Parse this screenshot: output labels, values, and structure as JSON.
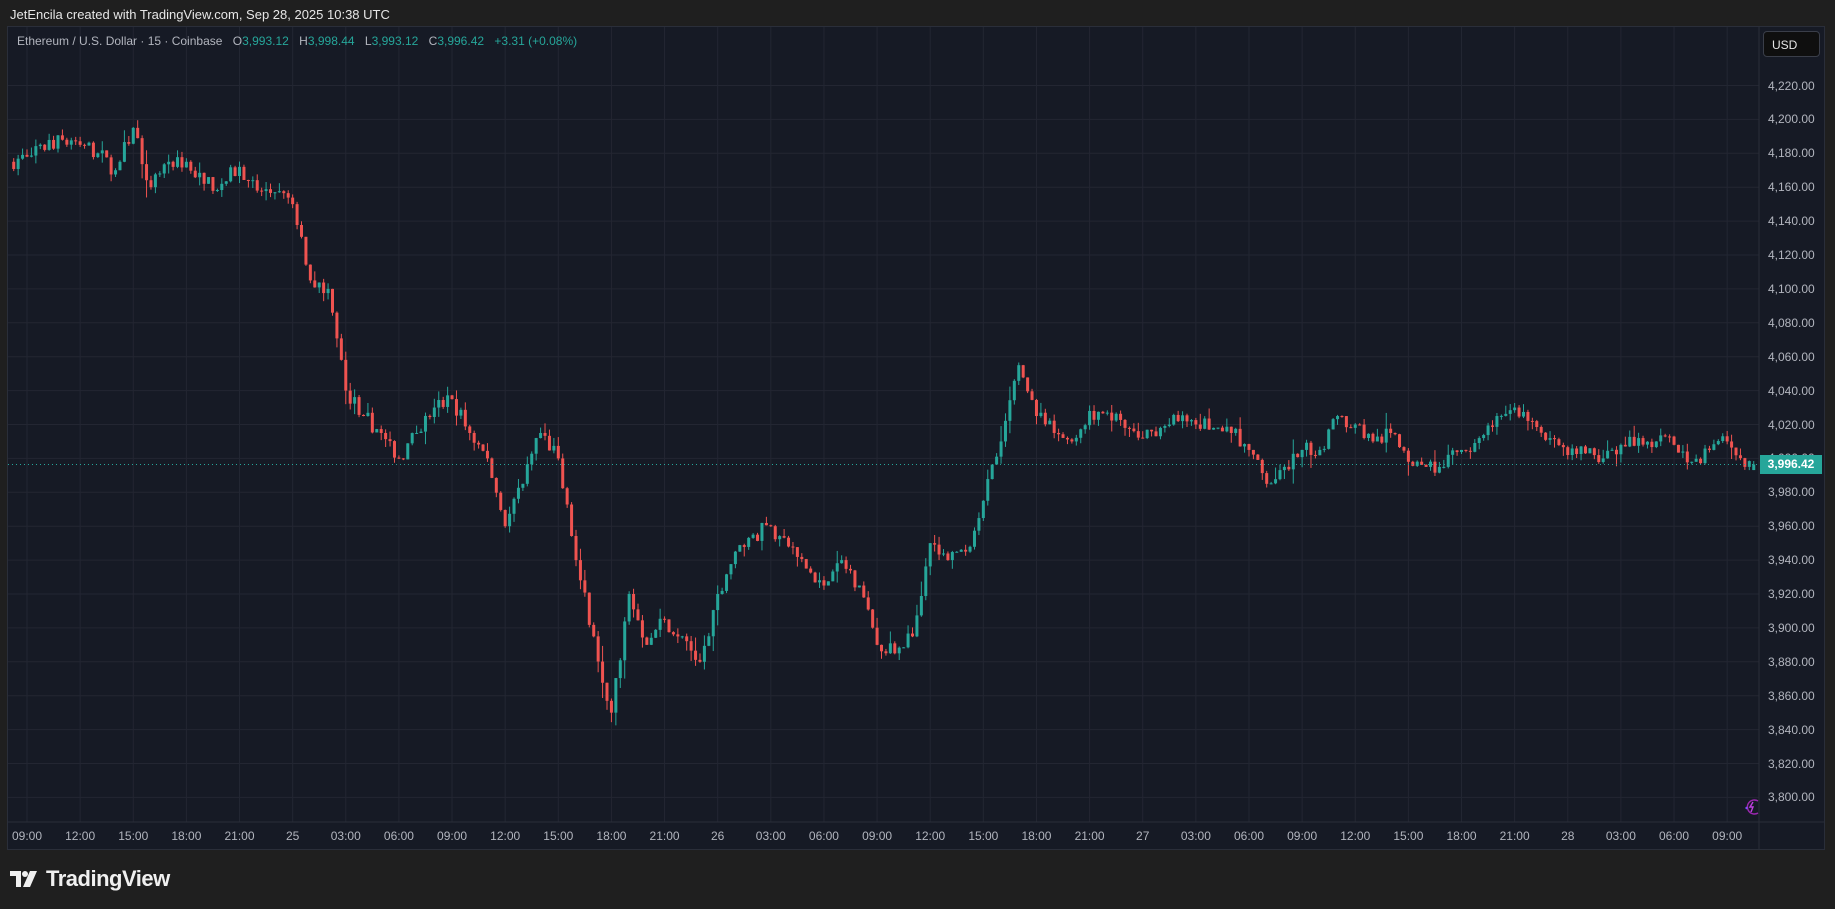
{
  "attribution": "JetEncila created with TradingView.com, Sep 28, 2025 10:38 UTC",
  "legend": {
    "symbol": "Ethereum / U.S. Dollar · 15 · Coinbase",
    "open_key": "O",
    "open": "3,993.12",
    "high_key": "H",
    "high": "3,998.44",
    "low_key": "L",
    "low": "3,993.12",
    "close_key": "C",
    "close": "3,996.42",
    "change": "+3.31 (+0.08%)"
  },
  "currency_button": "USD",
  "current_price_label": "3,996.42",
  "price_axis_labels": [
    "4,220.00",
    "4,200.00",
    "4,180.00",
    "4,160.00",
    "4,140.00",
    "4,120.00",
    "4,100.00",
    "4,080.00",
    "4,060.00",
    "4,040.00",
    "4,020.00",
    "4,000.00",
    "3,980.00",
    "3,960.00",
    "3,940.00",
    "3,920.00",
    "3,900.00",
    "3,880.00",
    "3,860.00",
    "3,840.00",
    "3,820.00",
    "3,800.00"
  ],
  "time_axis_labels": [
    "09:00",
    "12:00",
    "15:00",
    "18:00",
    "21:00",
    "25",
    "03:00",
    "06:00",
    "09:00",
    "12:00",
    "15:00",
    "18:00",
    "21:00",
    "26",
    "03:00",
    "06:00",
    "09:00",
    "12:00",
    "15:00",
    "18:00",
    "21:00",
    "27",
    "03:00",
    "06:00",
    "09:00",
    "12:00",
    "15:00",
    "18:00",
    "21:00",
    "28",
    "03:00",
    "06:00",
    "09:00"
  ],
  "logo": "TradingView",
  "colors": {
    "up": "#26a69a",
    "down": "#ef5350",
    "background": "#161a25",
    "grid": "#232632"
  },
  "chart_data": {
    "type": "candlestick",
    "interval": "15",
    "ylim": [
      3790,
      4232
    ],
    "last_candle": {
      "open": 3993.12,
      "high": 3998.44,
      "low": 3993.12,
      "close": 3996.42
    },
    "approx_hourly_close": [
      [
        "24 08:00",
        4175
      ],
      [
        "24 09:00",
        4178
      ],
      [
        "24 10:00",
        4182
      ],
      [
        "24 11:00",
        4188
      ],
      [
        "24 12:00",
        4185
      ],
      [
        "24 13:00",
        4180
      ],
      [
        "24 14:00",
        4170
      ],
      [
        "24 15:00",
        4195
      ],
      [
        "24 16:00",
        4160
      ],
      [
        "24 17:00",
        4175
      ],
      [
        "24 18:00",
        4175
      ],
      [
        "24 19:00",
        4162
      ],
      [
        "24 20:00",
        4162
      ],
      [
        "24 21:00",
        4172
      ],
      [
        "24 22:00",
        4158
      ],
      [
        "24 23:00",
        4157
      ],
      [
        "25 00:00",
        4150
      ],
      [
        "25 01:00",
        4105
      ],
      [
        "25 02:00",
        4100
      ],
      [
        "25 03:00",
        4040
      ],
      [
        "25 04:00",
        4025
      ],
      [
        "25 05:00",
        4015
      ],
      [
        "25 06:00",
        4000
      ],
      [
        "25 07:00",
        4015
      ],
      [
        "25 08:00",
        4030
      ],
      [
        "25 09:00",
        4035
      ],
      [
        "25 10:00",
        4015
      ],
      [
        "25 11:00",
        4000
      ],
      [
        "25 12:00",
        3960
      ],
      [
        "25 13:00",
        3985
      ],
      [
        "25 14:00",
        4015
      ],
      [
        "25 15:00",
        4000
      ],
      [
        "25 16:00",
        3940
      ],
      [
        "25 17:00",
        3895
      ],
      [
        "25 18:00",
        3850
      ],
      [
        "25 19:00",
        3920
      ],
      [
        "25 20:00",
        3890
      ],
      [
        "25 21:00",
        3905
      ],
      [
        "25 22:00",
        3895
      ],
      [
        "25 23:00",
        3880
      ],
      [
        "26 00:00",
        3920
      ],
      [
        "26 01:00",
        3945
      ],
      [
        "26 02:00",
        3955
      ],
      [
        "26 03:00",
        3960
      ],
      [
        "26 04:00",
        3948
      ],
      [
        "26 05:00",
        3935
      ],
      [
        "26 06:00",
        3925
      ],
      [
        "26 07:00",
        3940
      ],
      [
        "26 08:00",
        3925
      ],
      [
        "26 09:00",
        3890
      ],
      [
        "26 10:00",
        3885
      ],
      [
        "26 11:00",
        3895
      ],
      [
        "26 12:00",
        3950
      ],
      [
        "26 13:00",
        3940
      ],
      [
        "26 14:00",
        3945
      ],
      [
        "26 15:00",
        3975
      ],
      [
        "26 16:00",
        4010
      ],
      [
        "26 17:00",
        4055
      ],
      [
        "26 18:00",
        4025
      ],
      [
        "26 19:00",
        4015
      ],
      [
        "26 20:00",
        4010
      ],
      [
        "26 21:00",
        4028
      ],
      [
        "26 22:00",
        4027
      ],
      [
        "26 23:00",
        4018
      ],
      [
        "27 00:00",
        4012
      ],
      [
        "27 01:00",
        4018
      ],
      [
        "27 02:00",
        4022
      ],
      [
        "27 03:00",
        4020
      ],
      [
        "27 04:00",
        4018
      ],
      [
        "27 05:00",
        4015
      ],
      [
        "27 06:00",
        4005
      ],
      [
        "27 07:00",
        3985
      ],
      [
        "27 08:00",
        3995
      ],
      [
        "27 09:00",
        4005
      ],
      [
        "27 10:00",
        4005
      ],
      [
        "27 11:00",
        4025
      ],
      [
        "27 12:00",
        4020
      ],
      [
        "27 13:00",
        4010
      ],
      [
        "27 14:00",
        4015
      ],
      [
        "27 15:00",
        3998
      ],
      [
        "27 16:00",
        3995
      ],
      [
        "27 17:00",
        3995
      ],
      [
        "27 18:00",
        4005
      ],
      [
        "27 19:00",
        4012
      ],
      [
        "27 20:00",
        4025
      ],
      [
        "27 21:00",
        4030
      ],
      [
        "27 22:00",
        4022
      ],
      [
        "27 23:00",
        4012
      ],
      [
        "28 00:00",
        4002
      ],
      [
        "28 01:00",
        4003
      ],
      [
        "28 02:00",
        4000
      ],
      [
        "28 03:00",
        4008
      ],
      [
        "28 04:00",
        4012
      ],
      [
        "28 05:00",
        4010
      ],
      [
        "28 06:00",
        4008
      ],
      [
        "28 07:00",
        3998
      ],
      [
        "28 08:00",
        4005
      ],
      [
        "28 09:00",
        4010
      ],
      [
        "28 10:00",
        3995
      ],
      [
        "28 10:30",
        3996.42
      ]
    ]
  }
}
